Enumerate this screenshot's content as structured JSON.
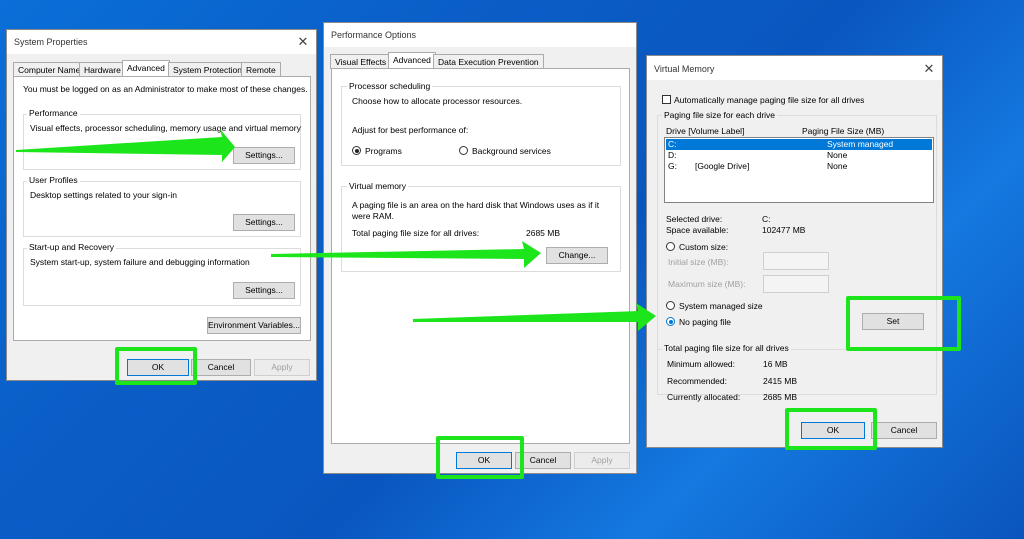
{
  "system_properties": {
    "title": "System Properties",
    "tabs": [
      "Computer Name",
      "Hardware",
      "Advanced",
      "System Protection",
      "Remote"
    ],
    "active_tab": "Advanced",
    "admin_note": "You must be logged on as an Administrator to make most of these changes.",
    "performance": {
      "label": "Performance",
      "desc": "Visual effects, processor scheduling, memory usage and virtual memory",
      "button": "Settings..."
    },
    "user_profiles": {
      "label": "User Profiles",
      "desc": "Desktop settings related to your sign-in",
      "button": "Settings..."
    },
    "startup": {
      "label": "Start-up and Recovery",
      "desc": "System start-up, system failure and debugging information",
      "button": "Settings..."
    },
    "env_button": "Environment Variables...",
    "ok": "OK",
    "cancel": "Cancel",
    "apply": "Apply"
  },
  "performance_options": {
    "title": "Performance Options",
    "tabs": [
      "Visual Effects",
      "Advanced",
      "Data Execution Prevention"
    ],
    "active_tab": "Advanced",
    "processor": {
      "label": "Processor scheduling",
      "desc": "Choose how to allocate processor resources.",
      "adjust": "Adjust for best performance of:",
      "opt_programs": "Programs",
      "opt_background": "Background services",
      "selected": "Programs"
    },
    "virtual_memory": {
      "label": "Virtual memory",
      "desc_line1": "A paging file is an area on the hard disk that Windows uses as if it",
      "desc_line2": "were RAM.",
      "total_label": "Total paging file size for all drives:",
      "total_value": "2685 MB",
      "button": "Change..."
    },
    "ok": "OK",
    "cancel": "Cancel",
    "apply": "Apply"
  },
  "virtual_memory": {
    "title": "Virtual Memory",
    "auto_manage": "Automatically manage paging file size for all drives",
    "auto_checked": false,
    "per_drive_label": "Paging file size for each drive",
    "col_drive": "Drive  [Volume Label]",
    "col_size": "Paging File Size (MB)",
    "drives": [
      {
        "drive": "C:",
        "label": "",
        "size": "System managed",
        "selected": true
      },
      {
        "drive": "D:",
        "label": "",
        "size": "None",
        "selected": false
      },
      {
        "drive": "G:",
        "label": "[Google Drive]",
        "size": "None",
        "selected": false
      }
    ],
    "selected_drive_label": "Selected drive:",
    "selected_drive_value": "C:",
    "space_label": "Space available:",
    "space_value": "102477 MB",
    "custom_size": "Custom size:",
    "initial_size": "Initial size (MB):",
    "max_size": "Maximum size (MB):",
    "system_managed": "System managed size",
    "no_paging": "No paging file",
    "selected_option": "No paging file",
    "set_button": "Set",
    "totals_label": "Total paging file size for all drives",
    "min_label": "Minimum allowed:",
    "min_value": "16 MB",
    "rec_label": "Recommended:",
    "rec_value": "2415 MB",
    "cur_label": "Currently allocated:",
    "cur_value": "2685 MB",
    "ok": "OK",
    "cancel": "Cancel"
  },
  "colors": {
    "highlight": "#1ce51c",
    "arrow": "#1ce51c",
    "desktop": "#0a5fc8",
    "selection": "#0078d7"
  }
}
